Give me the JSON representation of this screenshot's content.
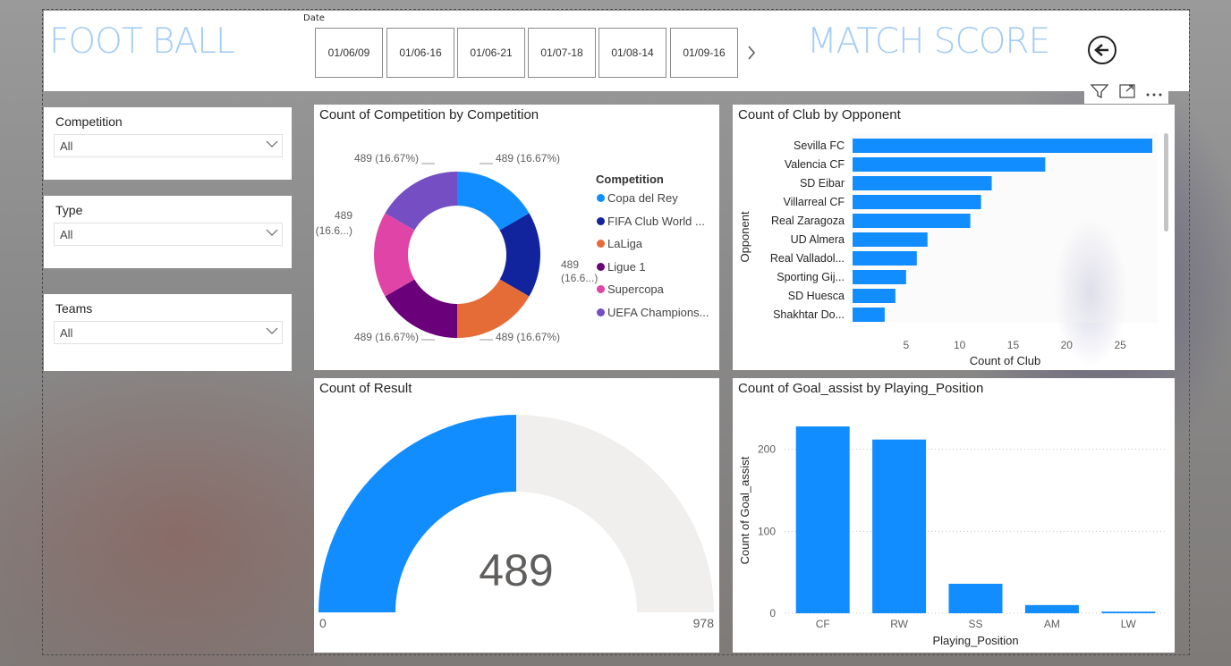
{
  "header": {
    "left_title": "FOOT BALL",
    "right_title": "MATCH SCORE",
    "date_label": "Date",
    "dates": [
      "01/06/09",
      "01/06-16",
      "01/06-21",
      "01/07-18",
      "01/08-14",
      "01/09-16"
    ]
  },
  "slicers": [
    {
      "title": "Competition",
      "value": "All"
    },
    {
      "title": "Type",
      "value": "All"
    },
    {
      "title": "Teams",
      "value": "All"
    }
  ],
  "donut": {
    "title": "Count of Competition by Competition",
    "legend_title": "Competition",
    "slices": [
      {
        "name": "Copa del Rey",
        "value": 489,
        "label": "489 (16.67%)",
        "color": "#118dff"
      },
      {
        "name": "FIFA Club World ...",
        "value": 489,
        "label": "489",
        "label2": "(16.6...)",
        "color": "#12239e"
      },
      {
        "name": "LaLiga",
        "value": 489,
        "label": "489 (16.67%)",
        "color": "#e66c37"
      },
      {
        "name": "Ligue 1",
        "value": 489,
        "label": "489 (16.67%)",
        "color": "#6b007b"
      },
      {
        "name": "Supercopa",
        "value": 489,
        "label": "489",
        "label2": "(16.6...)",
        "color": "#e044a7"
      },
      {
        "name": "UEFA Champions...",
        "value": 489,
        "label": "489 (16.67%)",
        "color": "#744ec2"
      }
    ]
  },
  "bar_h": {
    "title": "Count of Club by Opponent",
    "ylabel": "Opponent",
    "xlabel": "Count of Club",
    "categories": [
      "Sevilla FC",
      "Valencia CF",
      "SD Eibar",
      "Villarreal CF",
      "Real Zaragoza",
      "UD Almera",
      "Real Valladol...",
      "Sporting Gij...",
      "SD Huesca",
      "Shakhtar Do..."
    ],
    "values": [
      28,
      18,
      13,
      12,
      11,
      7,
      6,
      5,
      4,
      3
    ],
    "ticks": [
      5,
      10,
      15,
      20,
      25
    ],
    "xlim": [
      0,
      28.5
    ]
  },
  "gauge": {
    "title": "Count of Result",
    "value": 489,
    "min": 0,
    "max": 978,
    "value_label": "489",
    "min_label": "0",
    "max_label": "978"
  },
  "bar_v": {
    "title": "Count of Goal_assist by Playing_Position",
    "ylabel": "Count of Goal_assist",
    "xlabel": "Playing_Position",
    "categories": [
      "CF",
      "RW",
      "SS",
      "AM",
      "LW"
    ],
    "values": [
      228,
      212,
      36,
      10,
      2
    ],
    "ticks": [
      0,
      100,
      200
    ],
    "ylim": [
      0,
      240
    ]
  },
  "colors": {
    "accent": "#118dff",
    "title": "#a4cdf6"
  },
  "icons": [
    "chevron-right-icon",
    "back-arrow-icon",
    "filter-icon",
    "focus-mode-icon",
    "more-options-icon",
    "dropdown-caret-icon"
  ],
  "chart_data": [
    {
      "type": "pie",
      "title": "Count of Competition by Competition",
      "categories": [
        "Copa del Rey",
        "FIFA Club World ...",
        "LaLiga",
        "Ligue 1",
        "Supercopa",
        "UEFA Champions..."
      ],
      "values": [
        489,
        489,
        489,
        489,
        489,
        489
      ]
    },
    {
      "type": "bar",
      "title": "Count of Club by Opponent",
      "xlabel": "Count of Club",
      "ylabel": "Opponent",
      "categories": [
        "Sevilla FC",
        "Valencia CF",
        "SD Eibar",
        "Villarreal CF",
        "Real Zaragoza",
        "UD Almera",
        "Real Valladol...",
        "Sporting Gij...",
        "SD Huesca",
        "Shakhtar Do..."
      ],
      "values": [
        28,
        18,
        13,
        12,
        11,
        7,
        6,
        5,
        4,
        3
      ]
    },
    {
      "type": "bar",
      "title": "Count of Goal_assist by Playing_Position",
      "xlabel": "Playing_Position",
      "ylabel": "Count of Goal_assist",
      "categories": [
        "CF",
        "RW",
        "SS",
        "AM",
        "LW"
      ],
      "values": [
        228,
        212,
        36,
        10,
        2
      ],
      "ylim": [
        0,
        240
      ]
    }
  ]
}
